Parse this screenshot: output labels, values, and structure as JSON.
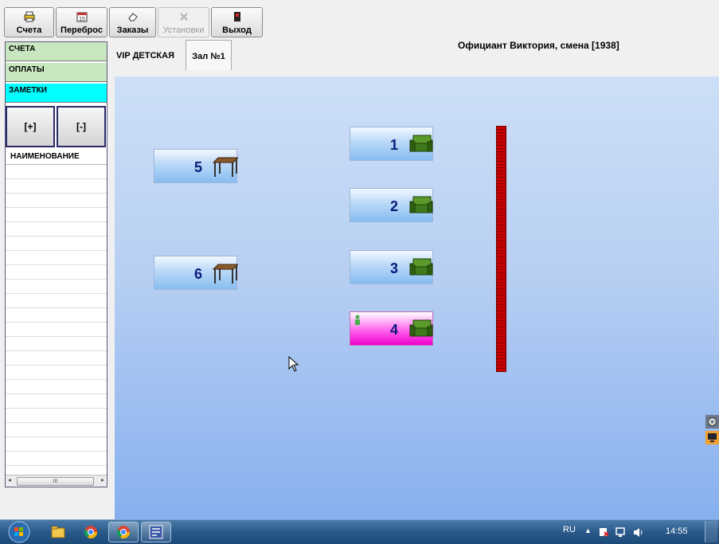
{
  "toolbar": {
    "buttons": [
      {
        "label": "Счета",
        "icon": "printer-icon"
      },
      {
        "label": "Переброс",
        "icon": "calendar-icon"
      },
      {
        "label": "Заказы",
        "icon": "eraser-icon"
      },
      {
        "label": "Установки",
        "icon": "tools-icon"
      },
      {
        "label": "Выход",
        "icon": "exit-icon"
      }
    ]
  },
  "waiter_label": "Официант Виктория, смена [1938]",
  "left_panel": {
    "sections": [
      "СЧЕТА",
      "ОПЛАТЫ",
      "ЗАМЕТКИ"
    ],
    "plus_label": "[+]",
    "minus_label": "[-]",
    "list_header": "НАИМЕНОВАНИЕ",
    "scroll_thumb": "III"
  },
  "halls": {
    "tabs": [
      "VIP ДЕТСКАЯ",
      "Зал №1"
    ],
    "active": "Зал №1"
  },
  "tables": [
    {
      "number": "1",
      "icon": "armchair-icon",
      "highlighted": false
    },
    {
      "number": "2",
      "icon": "armchair-icon",
      "highlighted": false
    },
    {
      "number": "3",
      "icon": "armchair-icon",
      "highlighted": false
    },
    {
      "number": "4",
      "icon": "armchair-icon",
      "highlighted": true
    },
    {
      "number": "5",
      "icon": "table-icon",
      "highlighted": false
    },
    {
      "number": "6",
      "icon": "table-icon",
      "highlighted": false
    }
  ],
  "colors": {
    "sections_bg": "#c8e6c0",
    "notes_bg": "#00ffff",
    "highlight": "#ee00cc",
    "table_number": "#0a1a7a",
    "bar": "#c80000"
  },
  "taskbar": {
    "apps": [
      "start-orb-icon",
      "explorer-icon",
      "chrome-icon",
      "chrome-icon",
      "pos-app-icon"
    ],
    "language": "RU",
    "time": "14:55"
  }
}
